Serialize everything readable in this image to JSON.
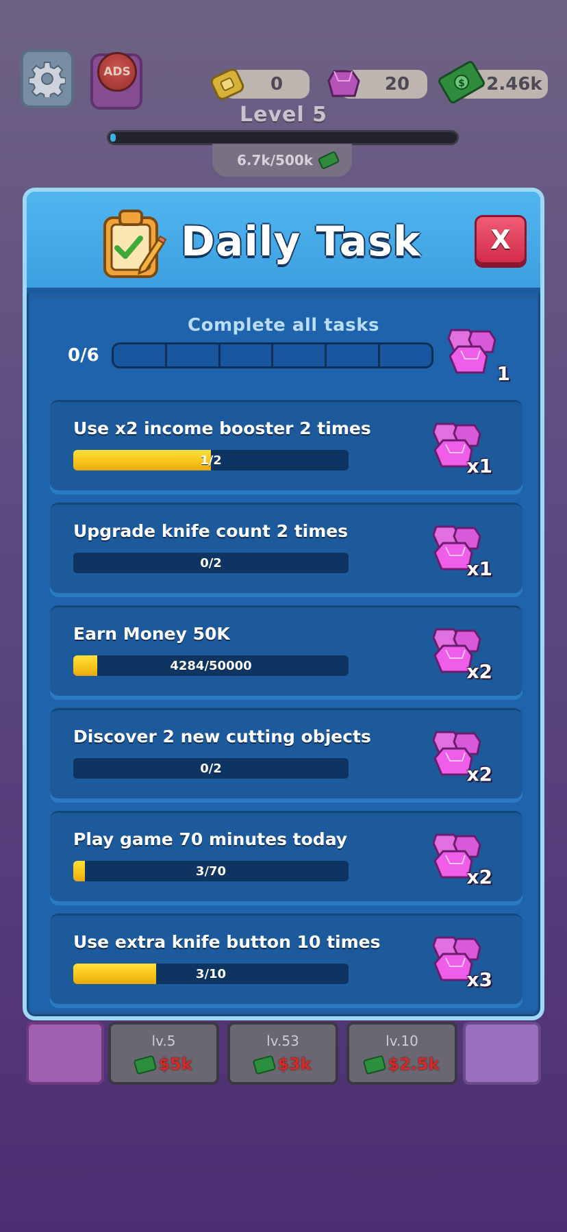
{
  "hud": {
    "settings_icon": "gear-icon",
    "ads_label": "ADS",
    "tickets": "0",
    "gems": "20",
    "cash": "2.46k",
    "level_label": "Level 5",
    "level_progress": 0.013,
    "xp_text": "6.7k/500k"
  },
  "modal": {
    "title": "Daily Task",
    "close_label": "X",
    "overall": {
      "label": "Complete all tasks",
      "count": "0/6",
      "completed": 0,
      "total": 6,
      "reward_mult": "1"
    },
    "tasks": [
      {
        "title": "Use x2 income booster 2 times",
        "progress": "1/2",
        "fraction": 0.5,
        "reward": "x1"
      },
      {
        "title": "Upgrade knife count 2 times",
        "progress": "0/2",
        "fraction": 0.0,
        "reward": "x1"
      },
      {
        "title": "Earn Money 50K",
        "progress": "4284/50000",
        "fraction": 0.086,
        "reward": "x2"
      },
      {
        "title": "Discover 2 new cutting objects",
        "progress": "0/2",
        "fraction": 0.0,
        "reward": "x2"
      },
      {
        "title": "Play game 70 minutes today",
        "progress": "3/70",
        "fraction": 0.043,
        "reward": "x2"
      },
      {
        "title": "Use extra knife button 10 times",
        "progress": "3/10",
        "fraction": 0.3,
        "reward": "x3"
      }
    ]
  },
  "shop": {
    "slots": [
      {
        "level": "lv.5",
        "price": "$5k"
      },
      {
        "level": "lv.53",
        "price": "$3k"
      },
      {
        "level": "lv.10",
        "price": "$2.5k"
      }
    ]
  },
  "colors": {
    "accent_blue": "#3e9fe0",
    "progress_yellow": "#f7c318",
    "close_red": "#d22c4a",
    "gem_pink": "#e64fd6"
  }
}
